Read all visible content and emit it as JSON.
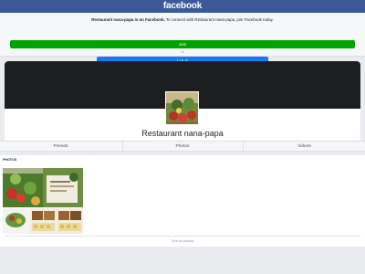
{
  "header": {
    "logo": "facebook"
  },
  "join_prompt": {
    "bold": "Restaurant nana-papa is on Facebook.",
    "rest": " To connect with Restaurant nana-papa, join Facebook today.",
    "join_label": "Join",
    "or_label": "or",
    "login_label": "Log In"
  },
  "page": {
    "name": "Restaurant nana-papa"
  },
  "tabs": [
    {
      "label": "Friends"
    },
    {
      "label": "Photos"
    },
    {
      "label": "Videos"
    }
  ],
  "photos": {
    "header": "PHOTOS",
    "see_all": "See all photos"
  },
  "colors": {
    "brand": "#3b5998",
    "join": "#00a400",
    "login": "#1877f2",
    "cover": "#1d1e20"
  }
}
